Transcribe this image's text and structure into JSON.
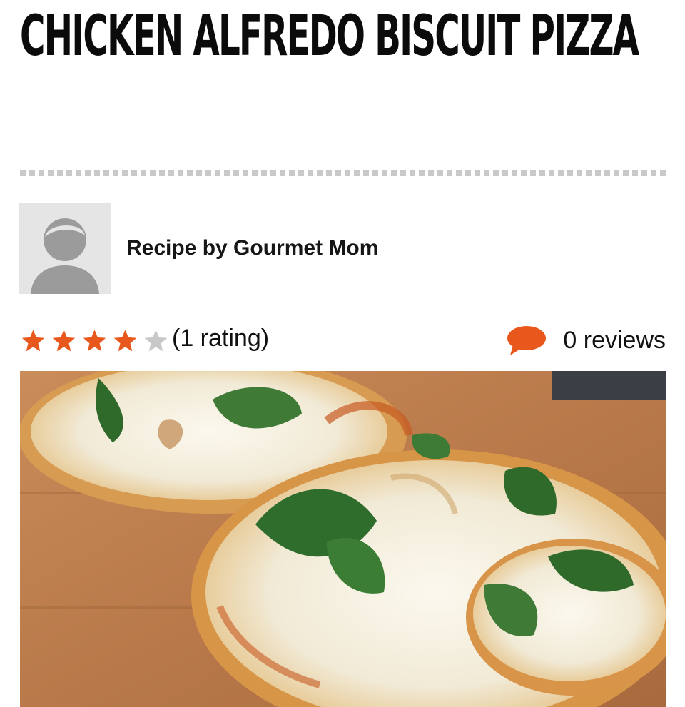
{
  "recipe": {
    "title": "CHICKEN ALFREDO BISCUIT PIZZA",
    "author_line": "Recipe by Gourmet Mom",
    "avatar_icon": "user-avatar-placeholder-icon",
    "rating": {
      "value": 4,
      "max": 5,
      "text": "(1 rating)",
      "star_icon": "star-icon",
      "filled_color": "#e8581c",
      "empty_color": "#c8c8c8"
    },
    "reviews": {
      "text": "0 reviews",
      "icon": "speech-bubble-icon",
      "icon_color": "#e8581c"
    },
    "photo": {
      "subject": "food-photo"
    }
  }
}
